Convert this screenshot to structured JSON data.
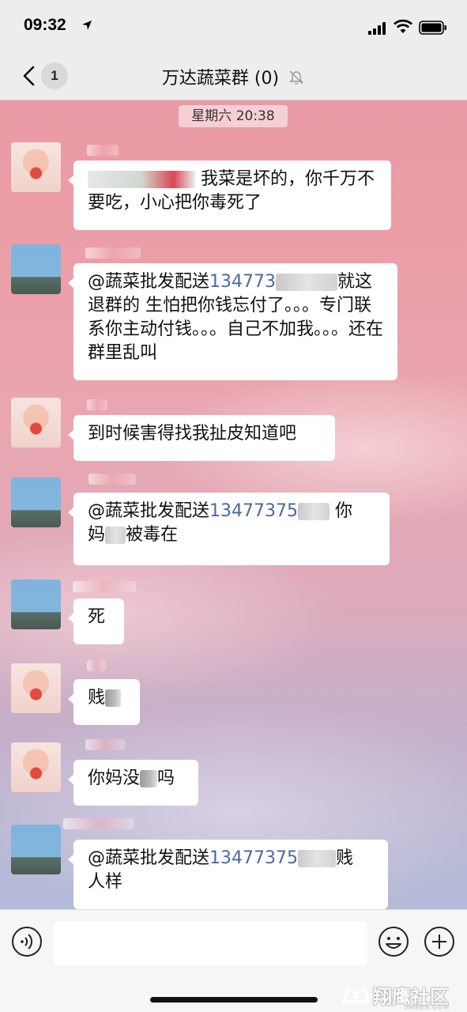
{
  "status_bar": {
    "time": "09:32"
  },
  "nav": {
    "back_badge": "1",
    "title": "万达蔬菜群 (0)"
  },
  "chat": {
    "timestamp": "星期六 20:38",
    "messages": [
      {
        "text": "我菜是坏的，你千万不要吃，小心把你毒死了"
      },
      {
        "mention": "@蔬菜批发配送",
        "number": "134773",
        "text": "就这 退群的 生怕把你钱忘付了。。。专门联系你主动付钱。。。自己不加我。。。还在群里乱叫"
      },
      {
        "text": "到时候害得找我扯皮知道吧"
      },
      {
        "mention": "@蔬菜批发配送",
        "number": "13477375",
        "text_after": "你",
        "text_line2a": "妈",
        "text_line2b": "被毒在"
      },
      {
        "text": "死"
      },
      {
        "text": "贱"
      },
      {
        "text_a": "你妈没",
        "text_b": "吗"
      },
      {
        "mention": "@蔬菜批发配送",
        "number": "13477375",
        "text_after": "贱",
        "text_line2": "人样"
      }
    ]
  },
  "watermark": {
    "text": "翔鹰社区",
    "sub": "JMBBS.COM"
  },
  "icons": {
    "back": "chevron-left-icon",
    "mute": "mute-bell-icon",
    "voice": "voice-icon",
    "emoji": "emoji-icon",
    "plus": "plus-icon"
  },
  "colors": {
    "mention_number": "#4a6aa0",
    "bubble": "#ffffff",
    "bar_bg": "#ededed"
  }
}
